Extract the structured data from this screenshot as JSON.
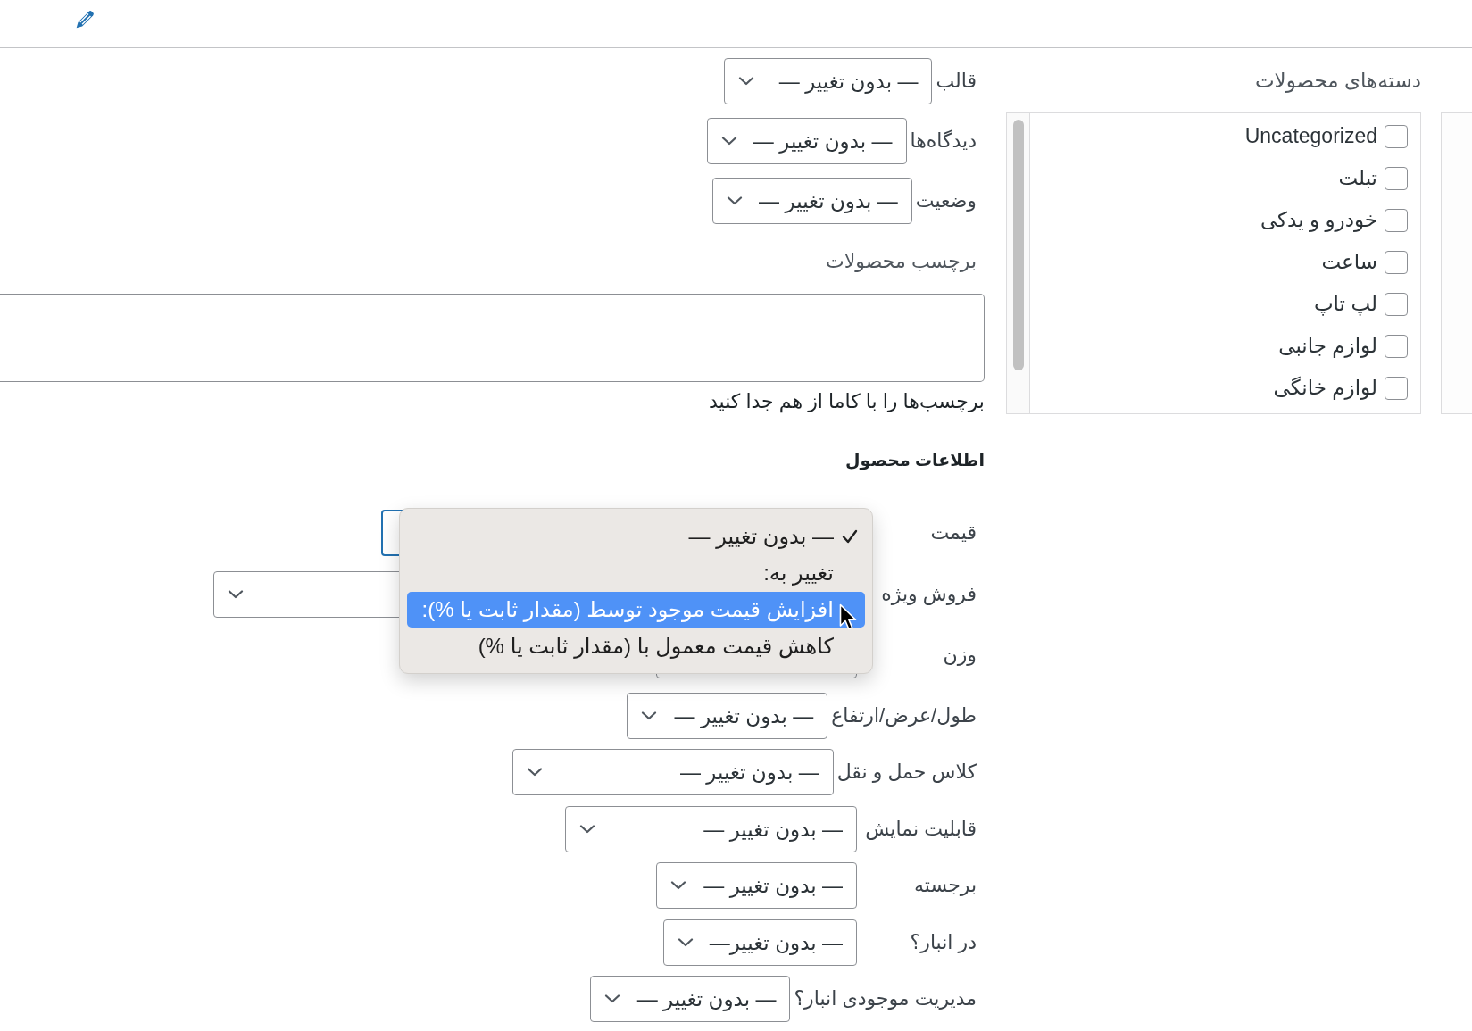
{
  "categories": {
    "label": "دسته‌های محصولات",
    "items": [
      {
        "label": "Uncategorized",
        "checked": false
      },
      {
        "label": "تبلت",
        "checked": false
      },
      {
        "label": "خودرو و یدکی",
        "checked": false
      },
      {
        "label": "ساعت",
        "checked": false
      },
      {
        "label": "لپ تاپ",
        "checked": false
      },
      {
        "label": "لوازم جانبی",
        "checked": false
      },
      {
        "label": "لوازم خانگی",
        "checked": false
      }
    ]
  },
  "fields": [
    {
      "label": "قالب",
      "value": "— بدون تغییر —"
    },
    {
      "label": "دیدگاه‌ها",
      "value": "— بدون تغییر —"
    },
    {
      "label": "وضعیت",
      "value": "— بدون تغییر —"
    }
  ],
  "tags": {
    "label": "برچسب محصولات",
    "hint": "برچسب‌ها را با کاما از هم جدا کنید"
  },
  "product_data": {
    "heading": "اطلاعات محصول",
    "fields": [
      {
        "label": "قیمت",
        "focused": true,
        "menu": [
          {
            "label": "— بدون تغییر —",
            "selected": true,
            "hovered": false
          },
          {
            "label": "تغییر به:",
            "selected": false,
            "hovered": false
          },
          {
            "label": "افزایش قیمت موجود توسط (مقدار ثابت یا %):",
            "selected": false,
            "hovered": true
          },
          {
            "label": "کاهش قیمت معمول با (مقدار ثابت یا %)",
            "selected": false,
            "hovered": false
          }
        ]
      },
      {
        "label": "فروش ویژه",
        "focused": false
      },
      {
        "label": "وزن",
        "focused": false
      },
      {
        "label": "طول/عرض/ارتفاع",
        "value": "— بدون تغییر —",
        "focused": false
      },
      {
        "label": "کلاس حمل و نقل",
        "value": "— بدون تغییر —",
        "focused": false
      },
      {
        "label": "قابلیت نمایش",
        "value": "— بدون تغییر —",
        "focused": false
      },
      {
        "label": "برجسته",
        "value": "— بدون تغییر —",
        "focused": false
      },
      {
        "label": "در انبار؟",
        "value": "— بدون تغییر—",
        "focused": false
      },
      {
        "label": "مدیریت موجودی انبار؟",
        "value": "— بدون تغییر —",
        "focused": false
      }
    ]
  }
}
